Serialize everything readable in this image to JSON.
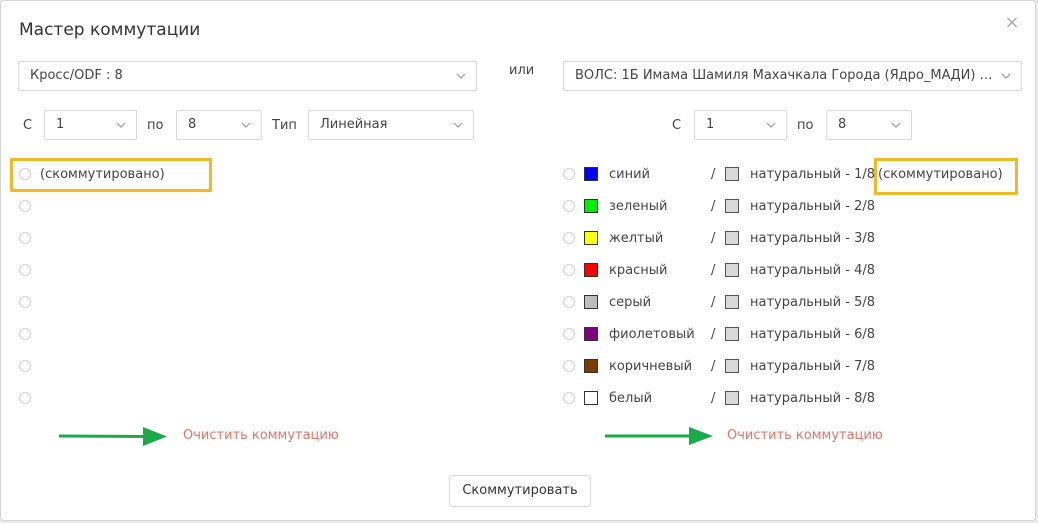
{
  "dialog": {
    "title": "Мастер коммутации",
    "close_glyph": "×",
    "or_label": "или",
    "submit_label": "Скоммутировать"
  },
  "left": {
    "source_select": "Кросс/ODF : 8",
    "from_label": "С",
    "from_value": "1",
    "to_label": "по",
    "to_value": "8",
    "type_label": "Тип",
    "type_value": "Линейная",
    "first_status": "(скоммутировано)",
    "clear_label": "Очистить коммутацию"
  },
  "right": {
    "source_select": "ВОЛС: 1Б Имама Шамиля Махачкала Города (Ядро_МАДИ) #...",
    "from_label": "С",
    "from_value": "1",
    "to_label": "по",
    "to_value": "8",
    "first_status": "(скоммутировано)",
    "clear_label": "Очистить коммутацию",
    "fibers": [
      {
        "color_name": "синий",
        "color": "#0000ff",
        "sep": "/",
        "tube_color": "#d9d9d9",
        "tube_label": "натуральный - 1/8"
      },
      {
        "color_name": "зеленый",
        "color": "#00ee00",
        "sep": "/",
        "tube_color": "#d9d9d9",
        "tube_label": "натуральный - 2/8"
      },
      {
        "color_name": "желтый",
        "color": "#ffff00",
        "sep": "/",
        "tube_color": "#d9d9d9",
        "tube_label": "натуральный - 3/8"
      },
      {
        "color_name": "красный",
        "color": "#ff0000",
        "sep": "/",
        "tube_color": "#d9d9d9",
        "tube_label": "натуральный - 4/8"
      },
      {
        "color_name": "серый",
        "color": "#bcbcbc",
        "sep": "/",
        "tube_color": "#d9d9d9",
        "tube_label": "натуральный - 5/8"
      },
      {
        "color_name": "фиолетовый",
        "color": "#800080",
        "sep": "/",
        "tube_color": "#d9d9d9",
        "tube_label": "натуральный - 6/8"
      },
      {
        "color_name": "коричневый",
        "color": "#7a3d00",
        "sep": "/",
        "tube_color": "#d9d9d9",
        "tube_label": "натуральный - 7/8"
      },
      {
        "color_name": "белый",
        "color": "#ffffff",
        "sep": "/",
        "tube_color": "#d9d9d9",
        "tube_label": "натуральный - 8/8"
      }
    ]
  },
  "colors": {
    "highlight": "#f0b823",
    "arrow": "#1aaa4a",
    "clear_link": "#e57368"
  }
}
